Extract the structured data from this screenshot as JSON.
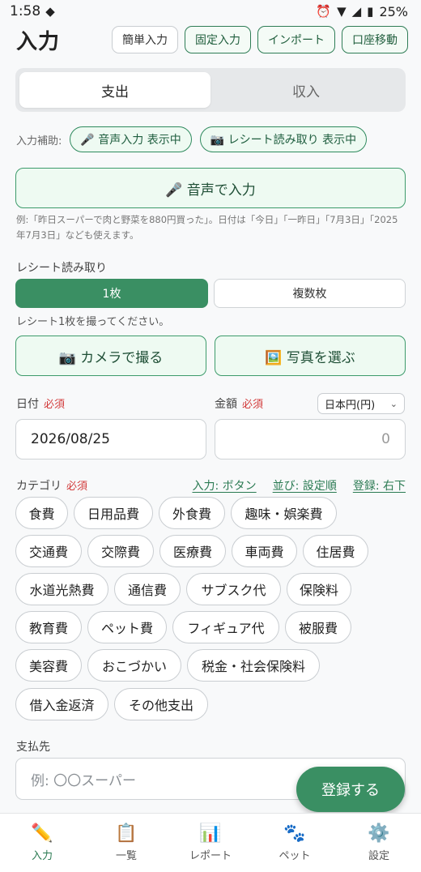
{
  "status": {
    "time": "1:58",
    "battery": "25%"
  },
  "header": {
    "title": "入力",
    "buttons": [
      "簡単入力",
      "固定入力",
      "インポート",
      "口座移動"
    ]
  },
  "type_tabs": [
    "支出",
    "収入"
  ],
  "assist": {
    "label": "入力補助:",
    "voice_pill": "🎤 音声入力 表示中",
    "receipt_pill": "📷 レシート読み取り 表示中"
  },
  "voice": {
    "button": "🎤 音声で入力",
    "hint": "例:「昨日スーパーで肉と野菜を880円買った」。日付は「今日」「一昨日」「7月3日」「2025年7月3日」なども使えます。"
  },
  "receipt": {
    "label": "レシート読み取り",
    "mode_single": "1枚",
    "mode_multi": "複数枚",
    "hint": "レシート1枚を撮ってください。",
    "camera": "📷 カメラで撮る",
    "photo": "🖼️ 写真を選ぶ"
  },
  "date": {
    "label": "日付",
    "required": "必須",
    "value": "2026/08/25"
  },
  "amount": {
    "label": "金額",
    "required": "必須",
    "currency": "日本円(円)",
    "placeholder": "0"
  },
  "category": {
    "label": "カテゴリ",
    "required": "必須",
    "links": [
      "入力: ボタン",
      "並び: 設定順",
      "登録: 右下"
    ],
    "chips": [
      "食費",
      "日用品費",
      "外食費",
      "趣味・娯楽費",
      "交通費",
      "交際費",
      "医療費",
      "車両費",
      "住居費",
      "水道光熱費",
      "通信費",
      "サブスク代",
      "保険料",
      "教育費",
      "ペット費",
      "フィギュア代",
      "被服費",
      "美容費",
      "おこづかい",
      "税金・社会保険料",
      "借入金返済",
      "その他支出"
    ]
  },
  "payee": {
    "label": "支払先",
    "placeholder": "例: 〇〇スーパー"
  },
  "submit": "登録する",
  "nav": [
    {
      "label": "入力",
      "icon": "pencil-icon"
    },
    {
      "label": "一覧",
      "icon": "clipboard-icon"
    },
    {
      "label": "レポート",
      "icon": "chart-icon"
    },
    {
      "label": "ペット",
      "icon": "paw-icon"
    },
    {
      "label": "設定",
      "icon": "gear-icon"
    }
  ],
  "colors": {
    "accent": "#3a8f63",
    "required": "#d23b3b"
  }
}
